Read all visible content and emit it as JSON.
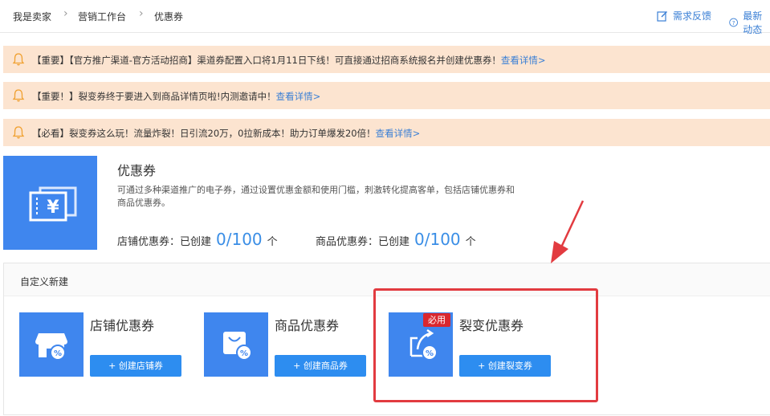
{
  "breadcrumb": {
    "items": [
      "我是卖家",
      "营销工作台",
      "优惠券"
    ]
  },
  "top_actions": {
    "feedback": "需求反馈",
    "latest": "最新动态"
  },
  "notices": [
    {
      "text": "【重要】【官方推广渠道-官方活动招商】渠道券配置入口将1月11日下线！可直接通过招商系统报名并创建优惠券！",
      "link": "查看详情>"
    },
    {
      "text": "【重要！】裂变券终于要进入到商品详情页啦!内测邀请中！",
      "link": "查看详情>"
    },
    {
      "text": "【必看】裂变券这么玩！流量炸裂！日引流20万，0拉新成本！助力订单爆发20倍！",
      "link": "查看详情>"
    }
  ],
  "intro": {
    "title": "优惠券",
    "description": "可通过多种渠道推广的电子券，通过设置优惠金额和使用门槛，刺激转化提高客单，包括店铺优惠券和商品优惠券。",
    "icon_symbol": "¥",
    "shop_stat": {
      "label": "店铺优惠券：已创建",
      "count": "0/100",
      "unit": "个"
    },
    "item_stat": {
      "label": "商品优惠券：已创建",
      "count": "0/100",
      "unit": "个"
    }
  },
  "custom": {
    "title": "自定义新建",
    "cards": [
      {
        "title": "店铺优惠券",
        "button": "+ 创建店铺券",
        "icon": "shop-coupon-icon"
      },
      {
        "title": "商品优惠券",
        "button": "+ 创建商品券",
        "icon": "bag-coupon-icon"
      },
      {
        "title": "裂变优惠券",
        "button": "+ 创建裂变券",
        "icon": "share-coupon-icon",
        "badge": "必用"
      }
    ]
  },
  "colors": {
    "primary": "#3f86ee",
    "button": "#2d8df0",
    "notice_bg": "#fce4d0",
    "highlight": "#e23b40",
    "badge": "#d9272e"
  }
}
